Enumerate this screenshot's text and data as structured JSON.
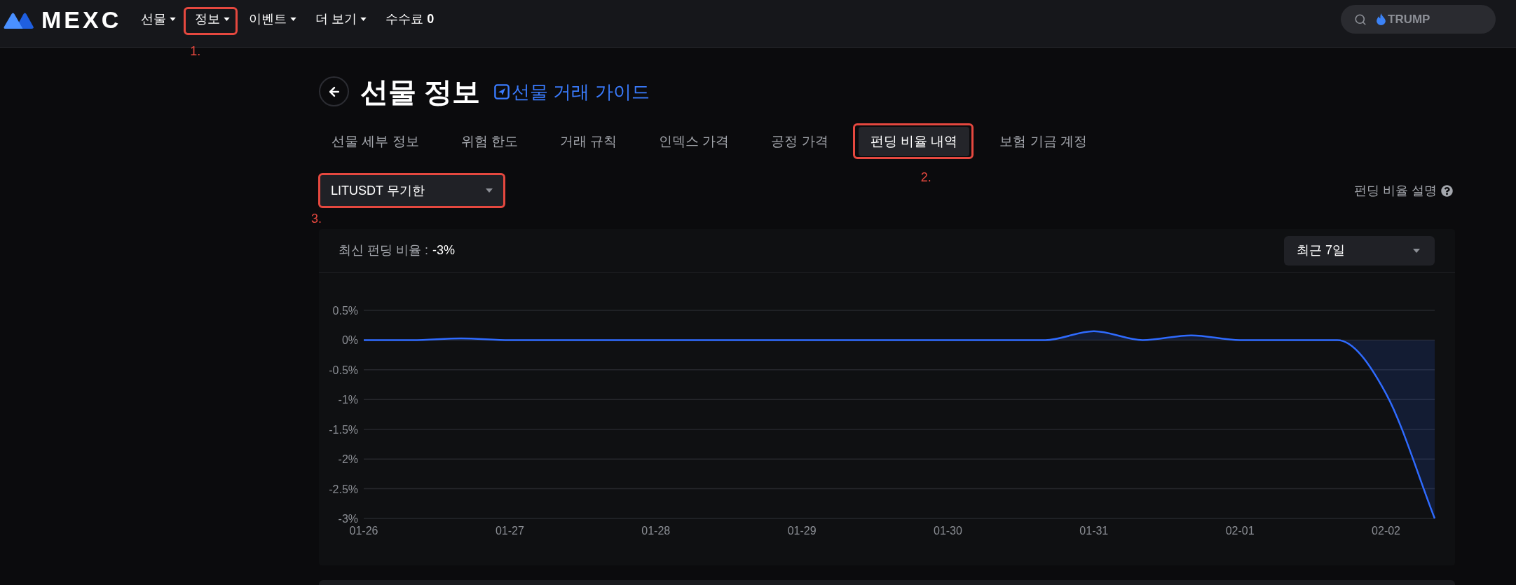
{
  "header": {
    "logo": "MEXC",
    "nav": [
      {
        "label": "선물",
        "dropdown": true
      },
      {
        "label": "정보",
        "dropdown": true,
        "callout": "1."
      },
      {
        "label": "이벤트",
        "dropdown": true
      },
      {
        "label": "더 보기",
        "dropdown": true
      },
      {
        "label": "수수료 **0**",
        "dropdown": false
      }
    ],
    "search": {
      "placeholder": "TRUMP"
    }
  },
  "page": {
    "title": "선물 정보",
    "guide_link": "선물 거래 가이드"
  },
  "tabs": [
    {
      "label": "선물 세부 정보",
      "selected": false
    },
    {
      "label": "위험 한도",
      "selected": false
    },
    {
      "label": "거래 규칙",
      "selected": false
    },
    {
      "label": "인덱스 가격",
      "selected": false
    },
    {
      "label": "공정 가격",
      "selected": false
    },
    {
      "label": "펀딩 비율 내역",
      "selected": true,
      "callout": "2."
    },
    {
      "label": "보험 기금 계정",
      "selected": false
    }
  ],
  "contract_select": {
    "value": "LITUSDT 무기한",
    "callout": "3."
  },
  "help_link": "펀딩 비율 설명",
  "rate_panel": {
    "latest_label": "최신 펀딩 비율 :",
    "latest_value": "-3%",
    "period_select": {
      "value": "최근 7일"
    },
    "chart_data": {
      "type": "area",
      "categories": [
        "01-26",
        null,
        null,
        "01-27",
        null,
        null,
        "01-28",
        null,
        null,
        "01-29",
        null,
        null,
        "01-30",
        null,
        null,
        "01-31",
        null,
        null,
        "02-01",
        null,
        null,
        "02-02",
        null
      ],
      "series": [
        {
          "color": "#2f6bff",
          "values": [
            0,
            0,
            0.03,
            0,
            0,
            0,
            0,
            0,
            0,
            0,
            0,
            0,
            0,
            0,
            0,
            0.15,
            0,
            0.08,
            0,
            0,
            0,
            -0.9,
            -3
          ]
        }
      ],
      "ylim": [
        -3,
        0.5
      ],
      "yticks": [
        {
          "value": 0.5,
          "label": "0.5%"
        },
        {
          "value": 0,
          "label": "0%"
        },
        {
          "value": -0.5,
          "label": "-0.5%"
        },
        {
          "value": -1,
          "label": "-1%"
        },
        {
          "value": -1.5,
          "label": "-1.5%"
        },
        {
          "value": -2,
          "label": "-2%"
        },
        {
          "value": -2.5,
          "label": "-2.5%"
        },
        {
          "value": -3,
          "label": "-3%"
        }
      ],
      "grid": true
    }
  }
}
